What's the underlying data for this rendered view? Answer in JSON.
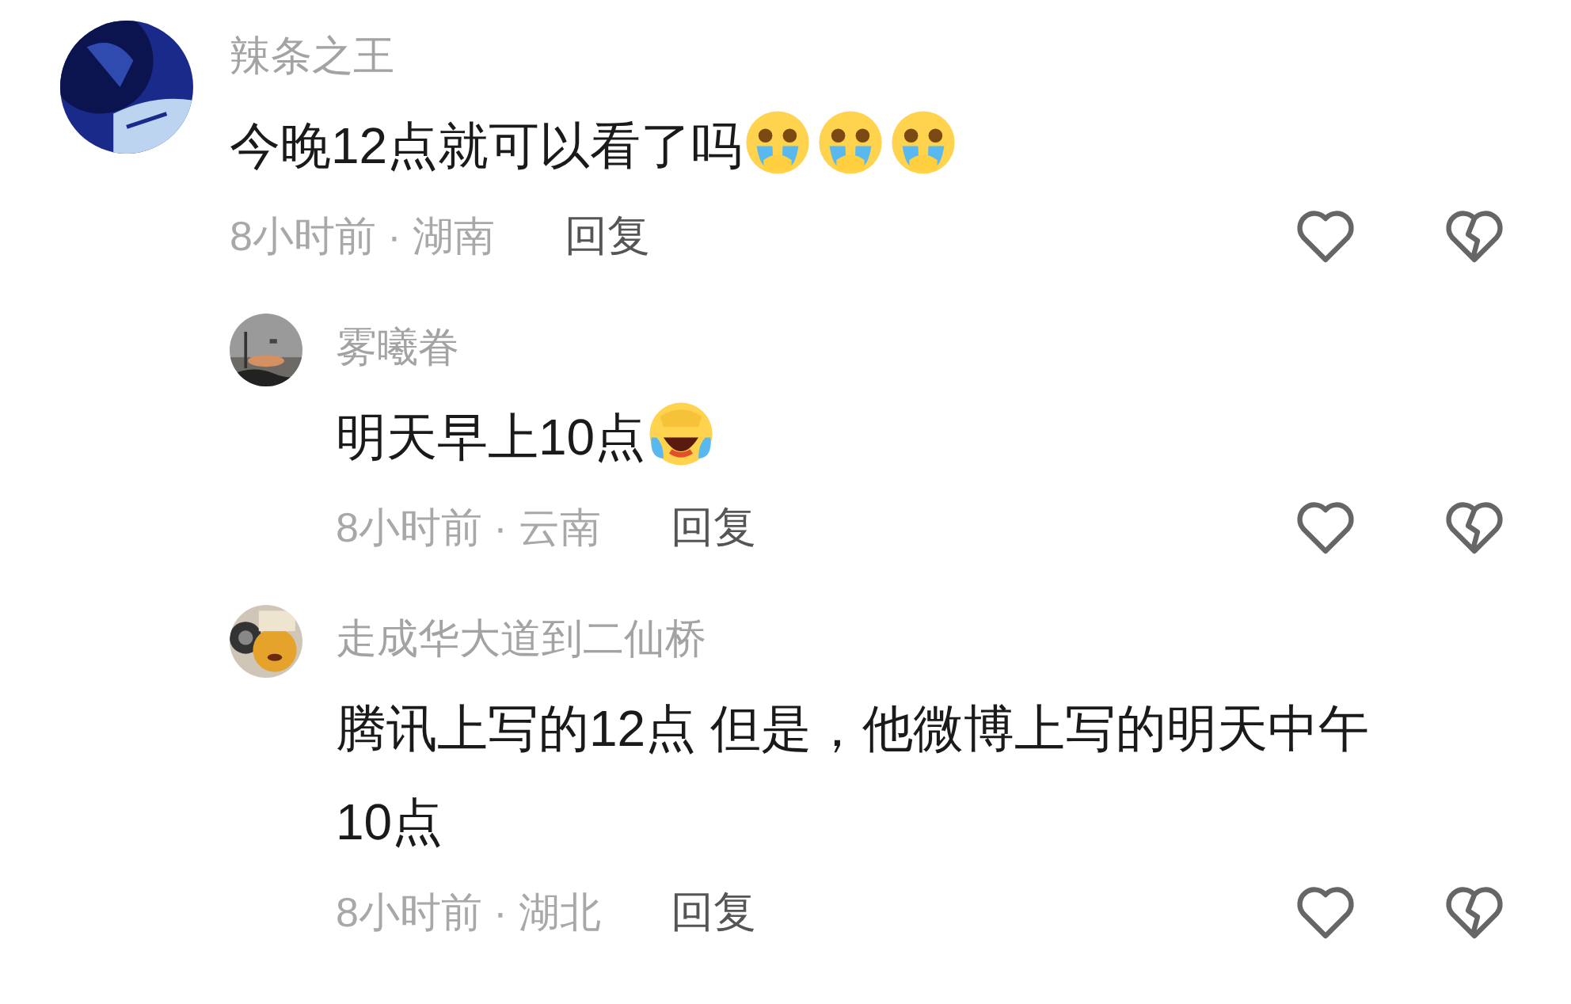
{
  "comments": [
    {
      "user": "辣条之王",
      "text": "今晚12点就可以看了吗",
      "emojis": [
        {
          "kind": "crying"
        },
        {
          "kind": "crying"
        },
        {
          "kind": "crying"
        }
      ],
      "time": "8小时前 · 湖南",
      "reply": "回复",
      "replies": [
        {
          "user": "雾曦眷",
          "text": "明天早上10点",
          "emojis": [
            {
              "kind": "laughing"
            }
          ],
          "time": "8小时前 · 云南",
          "reply": "回复"
        },
        {
          "user": "走成华大道到二仙桥",
          "text": "腾讯上写的12点 但是，他微博上写的明天中午10点",
          "time": "8小时前 · 湖北",
          "reply": "回复"
        }
      ]
    }
  ]
}
